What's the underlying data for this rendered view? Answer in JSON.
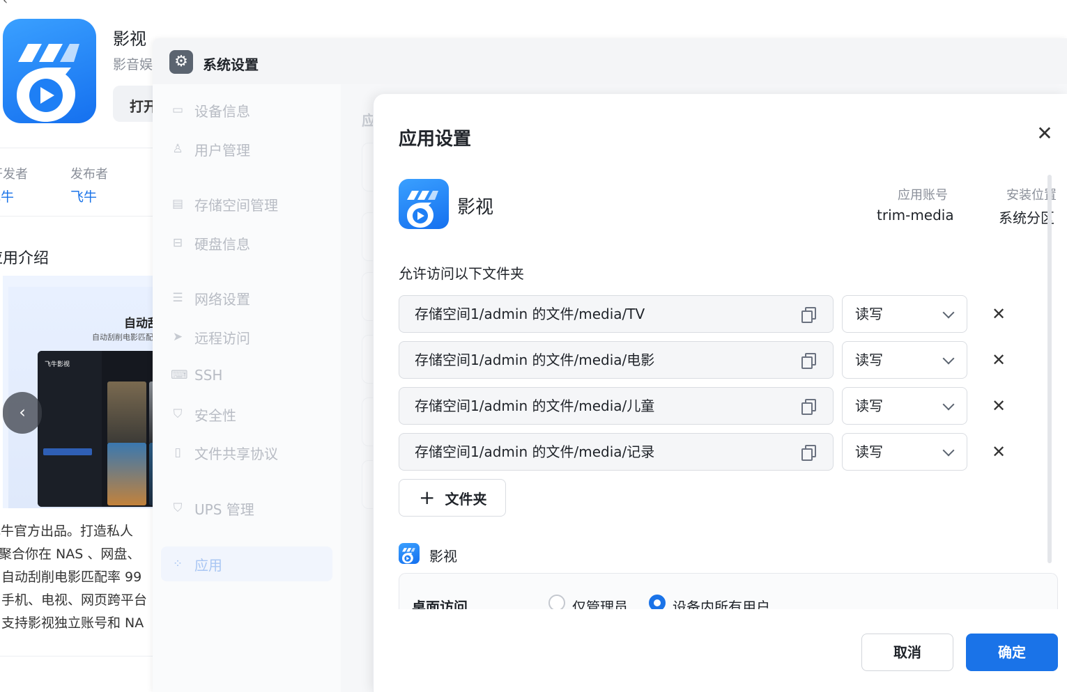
{
  "background_store": {
    "back_glyph": "‹",
    "app_name": "影视",
    "app_subtitle": "影音娱",
    "open_button": "打开",
    "meta": [
      {
        "label": "开发者",
        "value": "飞牛"
      },
      {
        "label": "发布者",
        "value": "飞牛"
      }
    ],
    "intro_heading": "应用介绍",
    "banner_title": "自动刮",
    "banner_subtitle": "自动刮削电影匹配",
    "banner_screen_brand": "飞牛影视",
    "prev_glyph": "‹",
    "description_lines": [
      "飞牛官方出品。打造私人",
      "聚合你在 NAS 、网盘、",
      "自动刮削电影匹配率 99",
      "手机、电视、网页跨平台",
      "支持影视独立账号和 NA"
    ]
  },
  "system_settings": {
    "title": "系统设置",
    "nav": [
      {
        "label": "设备信息",
        "icon": "device-icon"
      },
      {
        "label": "用户管理",
        "icon": "user-icon"
      },
      {
        "label": "存储空间管理",
        "icon": "storage-icon"
      },
      {
        "label": "硬盘信息",
        "icon": "disk-icon"
      },
      {
        "label": "网络设置",
        "icon": "network-icon"
      },
      {
        "label": "远程访问",
        "icon": "remote-icon"
      },
      {
        "label": "SSH",
        "icon": "code-icon"
      },
      {
        "label": "安全性",
        "icon": "shield-icon"
      },
      {
        "label": "文件共享协议",
        "icon": "file-icon"
      },
      {
        "label": "UPS 管理",
        "icon": "ups-shield-icon"
      },
      {
        "label": "应用",
        "icon": "apps-icon"
      }
    ],
    "active_nav": "应用",
    "content_heading": "应"
  },
  "modal": {
    "title": "应用设置",
    "close_glyph": "✕",
    "app_name": "影视",
    "account_label": "应用账号",
    "account_value": "trim-media",
    "location_label": "安装位置",
    "location_value": "系统分区",
    "folders_label": "允许访问以下文件夹",
    "folders": [
      {
        "path": "存储空间1/admin 的文件/media/TV",
        "permission": "读写"
      },
      {
        "path": "存储空间1/admin 的文件/media/电影",
        "permission": "读写"
      },
      {
        "path": "存储空间1/admin 的文件/media/儿童",
        "permission": "读写"
      },
      {
        "path": "存储空间1/admin 的文件/media/记录",
        "permission": "读写"
      }
    ],
    "remove_glyph": "✕",
    "add_folder_plus": "+",
    "add_folder_label": "文件夹",
    "sub_app_name": "影视",
    "desktop_access_label": "桌面访问",
    "desktop_access_options": [
      {
        "label": "仅管理员",
        "checked": false
      },
      {
        "label": "设备内所有用户",
        "checked": true
      }
    ],
    "cancel_label": "取消",
    "ok_label": "确定"
  },
  "colors": {
    "accent": "#1a73e8",
    "brand_gradient_start": "#3aa0ff",
    "brand_gradient_end": "#1570ef"
  }
}
